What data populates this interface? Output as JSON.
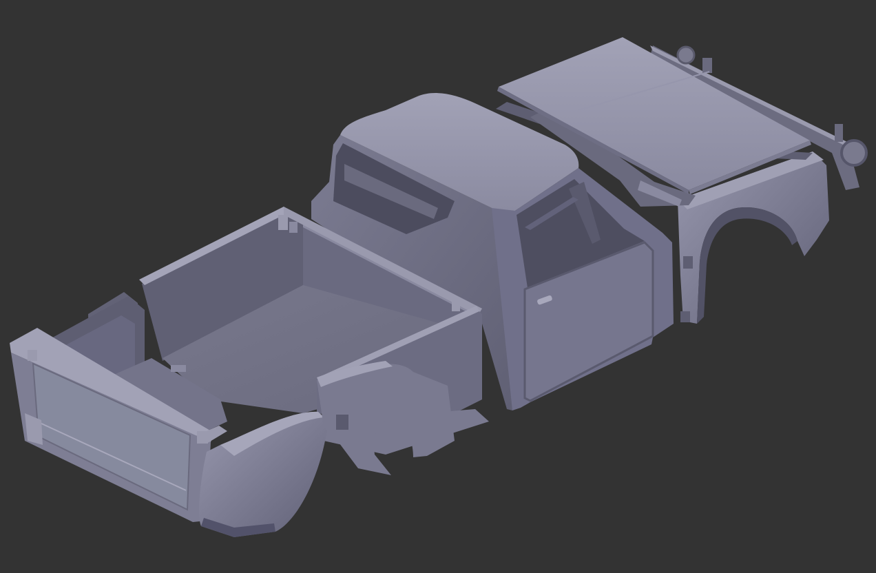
{
  "scene": {
    "background_color": "#333333",
    "model_colors": {
      "light": "#8e8ea4",
      "mid": "#77778c",
      "dark": "#5d5d70",
      "shadow": "#48485a",
      "highlight": "#a4a4b8"
    },
    "parts": [
      "tailgate",
      "truck-bed",
      "rear-fender-left",
      "cab",
      "door",
      "hood",
      "front-fender",
      "front-bumper"
    ]
  }
}
